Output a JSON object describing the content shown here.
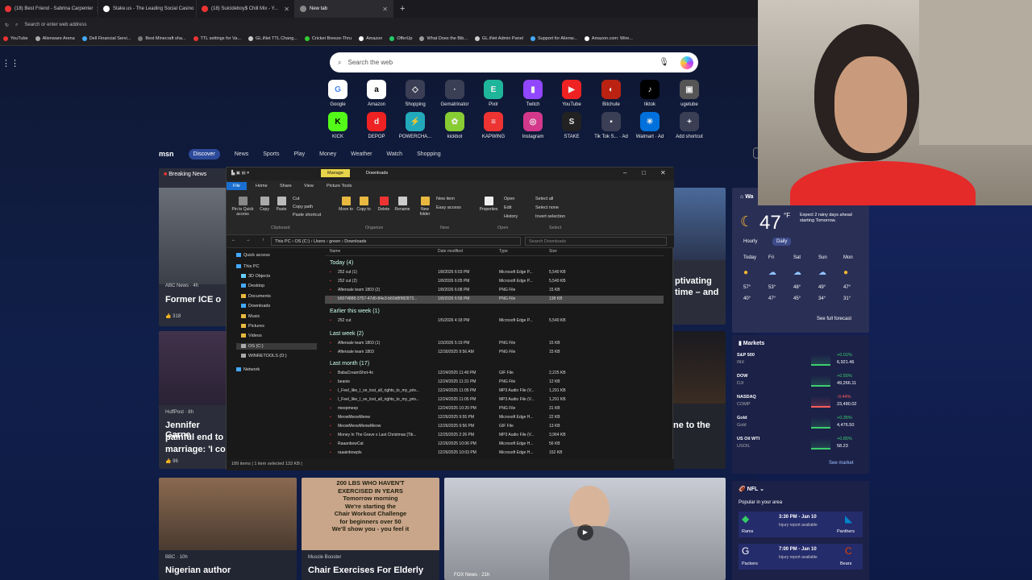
{
  "tabs": [
    {
      "label": "(18) Best Friend - Sabrina Carpenter",
      "icon_color": "#e33"
    },
    {
      "label": "Stake.us - The Leading Social Casino",
      "icon_color": "#fff"
    },
    {
      "label": "(18) Suicideboy$ Chill Mix - Y...",
      "icon_color": "#e33"
    },
    {
      "label": "New tab",
      "icon_color": "#888"
    }
  ],
  "address_placeholder": "Search or enter web address",
  "bookmarks": [
    "YouTube",
    "Alienware Arena",
    "Dell Financial Servi...",
    "Best Minecraft sha...",
    "TTL settings for Va...",
    "GL.iNet TTL Chang...",
    "Cricket Breeze-Thru",
    "Amazon",
    "OfferUp",
    "What Does the Bib...",
    "GL.iNet Admin Panel",
    "Support for Alienw...",
    "Amazon.com: Wire..."
  ],
  "search_placeholder": "Search the web",
  "shortcuts_row1": [
    "Google",
    "Amazon",
    "Shopping",
    "Gematrinator",
    "Pixlr",
    "Twitch",
    "YouTube",
    "Bitchute",
    "tiktok",
    "ugetube"
  ],
  "shortcuts_row2": [
    "KICK",
    "DEPOP",
    "POWERCHA...",
    "kickbot",
    "KAPWING",
    "Instagram",
    "STAKE",
    "Tik Tok S... · Ad",
    "Walmart · Ad",
    "Add shortcut"
  ],
  "msn_nav": {
    "logo": "msn",
    "discover": "Discover",
    "items": [
      "News",
      "Sports",
      "Play",
      "Money",
      "Weather",
      "Watch",
      "Shopping"
    ]
  },
  "breaking_label": "Breaking News",
  "cards": {
    "c1_source": "ABC News · 4h",
    "c1_title": "Former ICE o",
    "c1_likes": "318",
    "c2_source": "HuffPost · 8h",
    "c2_title_1": "Jennifer Garne",
    "c2_title_2": "painful end to",
    "c2_title_3": "marriage: 'I co",
    "c2_likes": "96",
    "c3_source": "BBC · 10h",
    "c3_title": "Nigerian author",
    "c4_source": "Muscle Booster",
    "c4_title": "Chair Exercises For Elderly",
    "c4_ad_1": "200 LBS WHO HAVEN'T",
    "c4_ad_2": "EXERCISED IN YEARS",
    "c4_ad_3": "Tomorrow morning",
    "c4_ad_4": "We're starting the",
    "c4_ad_5": "Chair Workout Challenge",
    "c4_ad_6": "for beginners over 50",
    "c4_ad_7": "We'll show you - you feel it",
    "c5_source": "FOX News · 21h",
    "c6_title_1": "ptivating",
    "c6_title_2": "time – and",
    "c7_title": "ne to the"
  },
  "explorer": {
    "manage": "Manage",
    "title": "Downloads",
    "ribbon_tabs": [
      "File",
      "Home",
      "Share",
      "View",
      "Picture Tools"
    ],
    "buttons": [
      "Pin to Quick access",
      "Copy",
      "Paste",
      "Move to",
      "Copy to",
      "Delete",
      "Rename",
      "New folder",
      "Properties"
    ],
    "small_buttons": [
      "Cut",
      "Copy path",
      "Paste shortcut",
      "New item",
      "Easy access",
      "Open",
      "Edit",
      "History",
      "Select all",
      "Select none",
      "Invert selection"
    ],
    "groups": [
      "Clipboard",
      "Organize",
      "New",
      "Open",
      "Select"
    ],
    "path": [
      "This PC",
      "OS (C:)",
      "Users",
      "green",
      "Downloads"
    ],
    "search_placeholder": "Search Downloads",
    "columns": [
      "Name",
      "Date modified",
      "Type",
      "Size"
    ],
    "sidebar": [
      "Quick access",
      "This PC",
      "3D Objects",
      "Desktop",
      "Documents",
      "Downloads",
      "Music",
      "Pictures",
      "Videos",
      "OS (C:)",
      "WINRETOOLS (D:)",
      "Network"
    ],
    "group_today": "Today (4)",
    "group_earlier_week": "Earlier this week (1)",
    "group_last_week": "Last week (2)",
    "group_last_month": "Last month (17)",
    "files_today": [
      [
        "252 cut (1)",
        "1/8/2026 6:03 PM",
        "Microsoft Edge P...",
        "5,540 KB"
      ],
      [
        "252 cut (2)",
        "1/8/2026 6:05 PM",
        "Microsoft Edge P...",
        "5,540 KB"
      ],
      [
        "Aftersale team 1803 (2)",
        "1/8/2026 6:08 PM",
        "PNG File",
        "15 KB"
      ],
      [
        "b5074888-3757-47d0-84e3-b60d8f982873...",
        "1/8/2026 6:58 PM",
        "PNG File",
        "138 KB"
      ]
    ],
    "files_week": [
      [
        "252 cut",
        "1/5/2026 4:18 PM",
        "Microsoft Edge P...",
        "5,540 KB"
      ]
    ],
    "files_lastweek": [
      [
        "Aftersale team 1803 (1)",
        "1/3/2026 5:19 PM",
        "PNG File",
        "15 KB"
      ],
      [
        "Aftersale team 1803",
        "12/30/2025 9:56 AM",
        "PNG File",
        "15 KB"
      ]
    ],
    "files_month": [
      [
        "BabaCreamShot-4x",
        "12/24/2025 11:40 PM",
        "GIF File",
        "2,225 KB"
      ],
      [
        "beanie",
        "12/24/2025 11:31 PM",
        "PNG File",
        "12 KB"
      ],
      [
        "I_Feel_like_I_ve_lost_all_rights_to_my_priv...",
        "12/24/2025 11:05 PM",
        "MP3 Audio File (V...",
        "1,291 KB"
      ],
      [
        "I_Feel_like_I_ve_lost_all_rights_to_my_priv...",
        "12/24/2025 11:05 PM",
        "MP3 Audio File (V...",
        "1,291 KB"
      ],
      [
        "meepmeep",
        "12/24/2025 10:20 PM",
        "PNG File",
        "31 KB"
      ],
      [
        "MeowMeowMeow",
        "12/26/2025 9:55 PM",
        "Microsoft Edge H...",
        "22 KB"
      ],
      [
        "MeowMeowMeowMeow",
        "12/26/2025 9:56 PM",
        "GIF File",
        "13 KB"
      ],
      [
        "Money In The Grave x Last Christmas [Tik...",
        "12/25/2025 2:26 PM",
        "MP3 Audio File (V...",
        "3,964 KB"
      ],
      [
        "RaaanbowCat",
        "12/26/2025 10:06 PM",
        "Microsoft Edge H...",
        "56 KB"
      ],
      [
        "raaainbowpls",
        "12/26/2025 10:03 PM",
        "Microsoft Edge H...",
        "152 KB"
      ]
    ],
    "status": "189 items  |  1 item selected 133 KB  |"
  },
  "weather": {
    "title": "Wa",
    "temp": "47",
    "note": "Expect 2 rainy days ahead starting Tomorrow.",
    "tabs": [
      "Hourly",
      "Daily"
    ],
    "days": [
      "Today",
      "Fri",
      "Sat",
      "Sun",
      "Mon"
    ],
    "highs": [
      "57°",
      "53°",
      "48°",
      "49°",
      "47°"
    ],
    "lows": [
      "40°",
      "47°",
      "45°",
      "34°",
      "31°"
    ],
    "forecast_link": "See full forecast"
  },
  "markets": {
    "title": "Markets",
    "items": [
      {
        "name": "S&P 500",
        "sub": "INX",
        "change": "+0.01%",
        "value": "6,921.46",
        "color": "#3ccf6e"
      },
      {
        "name": "DOW",
        "sub": "DJI",
        "change": "+0.55%",
        "value": "49,266.11",
        "color": "#3ccf6e"
      },
      {
        "name": "NASDAQ",
        "sub": "COMP",
        "change": "-0.44%",
        "value": "23,480.02",
        "color": "#ff5c5c"
      },
      {
        "name": "Gold",
        "sub": "Gold",
        "change": "+0.35%",
        "value": "4,476.50",
        "color": "#3ccf6e"
      },
      {
        "name": "US Oil WTI",
        "sub": "USOIL",
        "change": "+0.85%",
        "value": "58.23",
        "color": "#3ccf6e"
      }
    ],
    "see_market": "See market"
  },
  "nfl": {
    "title": "NFL",
    "subtitle": "Popular in your area",
    "games": [
      {
        "time": "3:30 PM - Jan 10",
        "note": "Injury report available",
        "home": "Rams",
        "away": "Panthers"
      },
      {
        "time": "7:00 PM - Jan 10",
        "note": "Injury report available",
        "home": "Packers",
        "away": "Bears"
      }
    ]
  }
}
